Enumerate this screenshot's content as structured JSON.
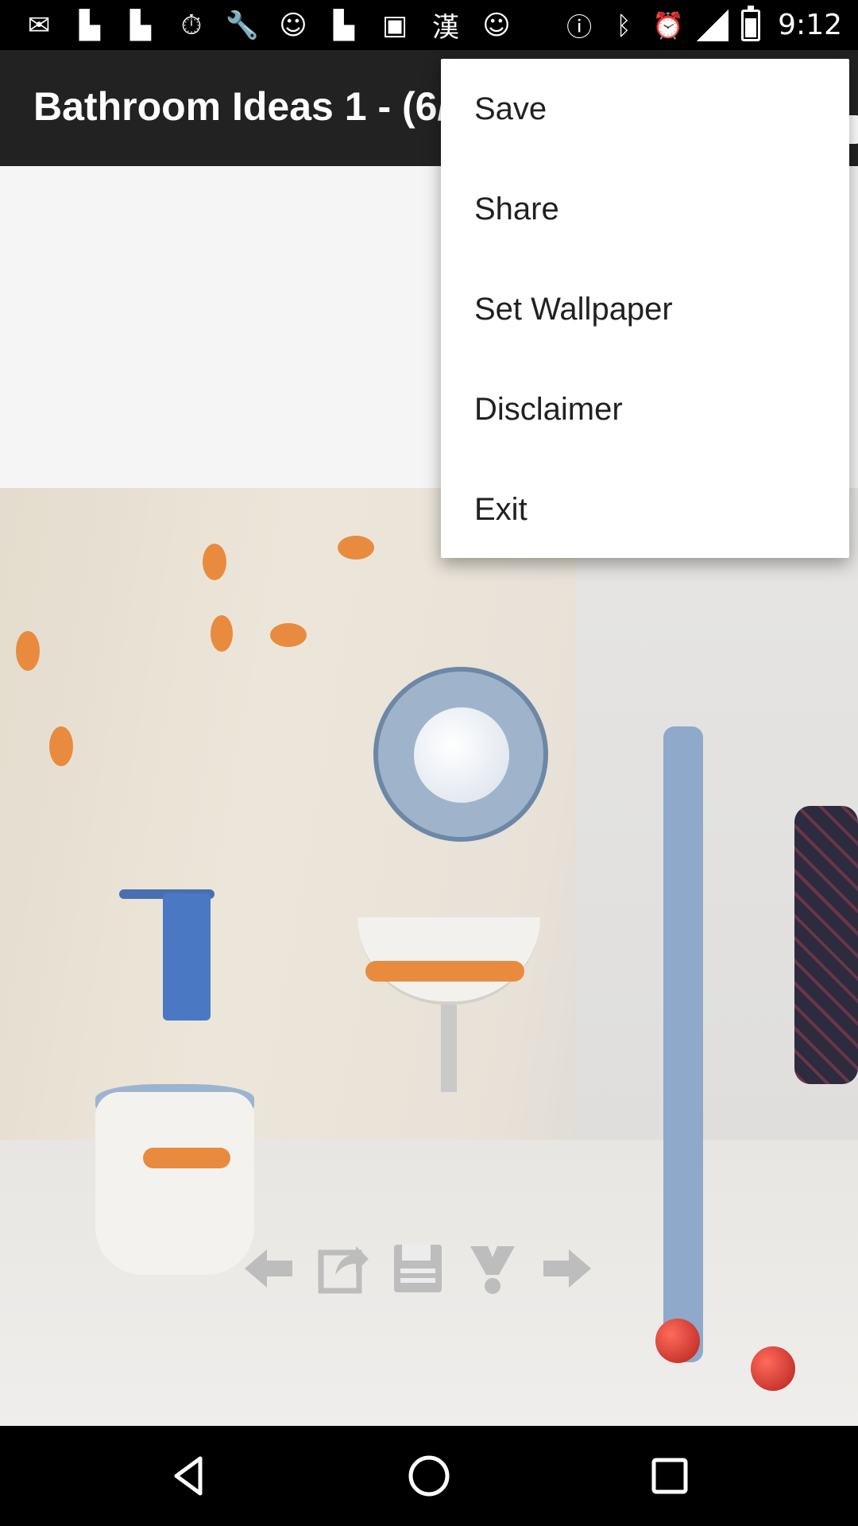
{
  "status_bar": {
    "time": "9:12",
    "left_icons": [
      "messages-icon",
      "flipboard-icon",
      "flipboard-icon",
      "timer-icon",
      "wrench-icon",
      "smiley-icon",
      "flipboard-icon",
      "qt-icon",
      "chinese-char-icon",
      "smiley-icon"
    ],
    "right_icons": [
      "alert-icon",
      "bluetooth-icon",
      "alarm-icon",
      "signal-icon",
      "battery-icon"
    ]
  },
  "app_bar": {
    "title": "Bathroom Ideas 1 - (6/"
  },
  "menu": {
    "items": [
      "Save",
      "Share",
      "Set Wallpaper",
      "Disclaimer",
      "Exit"
    ]
  },
  "toolbar": {
    "icons": [
      "arrow-left-icon",
      "share-export-icon",
      "save-floppy-icon",
      "wallpaper-icon",
      "arrow-right-icon"
    ]
  },
  "nav_bar": {
    "icons": [
      "back-icon",
      "home-icon",
      "recents-icon"
    ]
  },
  "colors": {
    "app_bar": "#222222",
    "menu_bg": "#ffffff",
    "menu_text": "#212121",
    "content_bg": "#f5f5f5"
  }
}
